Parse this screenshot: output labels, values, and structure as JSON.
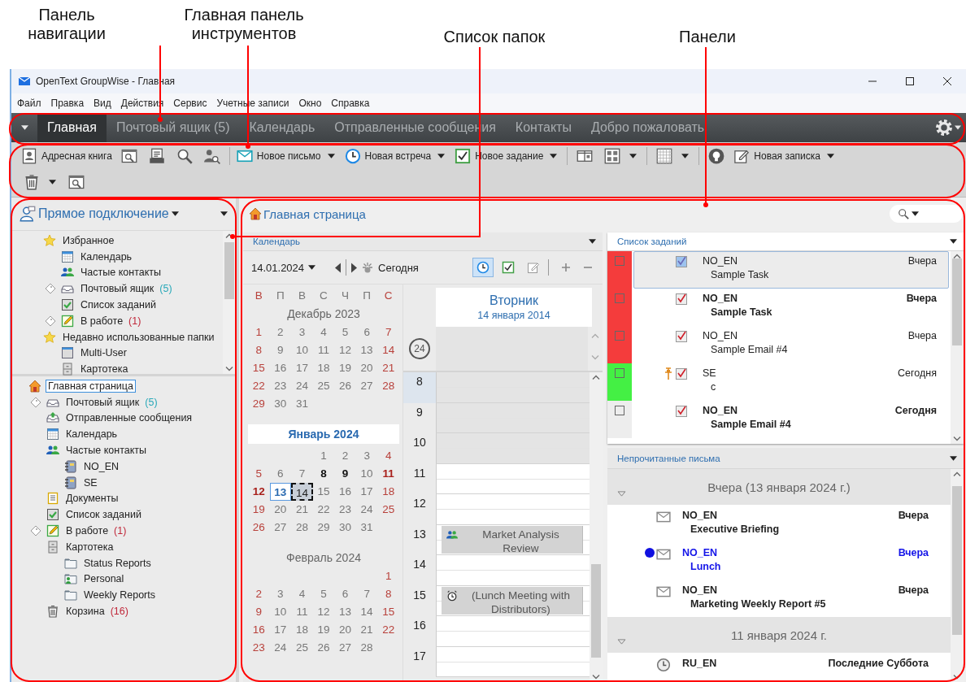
{
  "annotations": [
    {
      "label": "Панель навигации"
    },
    {
      "label": "Главная панель инструментов"
    },
    {
      "label": "Список папок"
    },
    {
      "label": "Панели"
    }
  ],
  "window": {
    "title": "OpenText GroupWise - Главная"
  },
  "menu": [
    "Файл",
    "Правка",
    "Вид",
    "Действия",
    "Сервис",
    "Учетные записи",
    "Окно",
    "Справка"
  ],
  "nav_tabs": [
    {
      "label": "Главная",
      "selected": true
    },
    {
      "label": "Почтовый ящик (5)",
      "selected": false
    },
    {
      "label": "Календарь",
      "selected": false
    },
    {
      "label": "Отправленные сообщения",
      "selected": false
    },
    {
      "label": "Контакты",
      "selected": false
    },
    {
      "label": "Добро пожаловать",
      "selected": false
    }
  ],
  "toolbar": {
    "rows": [
      [
        {
          "kind": "button",
          "label": "Адресная книга"
        },
        {
          "kind": "icon"
        },
        {
          "kind": "icon"
        },
        {
          "kind": "icon"
        },
        {
          "kind": "icon"
        },
        {
          "kind": "separator"
        },
        {
          "kind": "button",
          "label": "Новое письмо",
          "menu": true
        },
        {
          "kind": "button",
          "label": "Новая встреча",
          "menu": true
        },
        {
          "kind": "button",
          "label": "Новое задание",
          "menu": true
        },
        {
          "kind": "separator"
        },
        {
          "kind": "icon"
        },
        {
          "kind": "icon",
          "menu": true
        },
        {
          "kind": "separator"
        },
        {
          "kind": "icon",
          "menu": true
        },
        {
          "kind": "separator"
        },
        {
          "kind": "icon"
        },
        {
          "kind": "button",
          "label": "Новая записка",
          "menu": true
        }
      ],
      [
        {
          "kind": "icon",
          "menu": true
        },
        {
          "kind": "icon"
        }
      ]
    ]
  },
  "folder_panel": {
    "title": "Прямое подключение",
    "favorites": [
      {
        "label": "Избранное",
        "kind": "favorites",
        "selected": false,
        "children": [
          {
            "label": "Календарь",
            "kind": "calendar",
            "selected": false
          },
          {
            "label": "Частые контакты",
            "kind": "contacts",
            "selected": false
          },
          {
            "label": "Почтовый ящик",
            "count": "(5)",
            "color": "#2aa9b9",
            "kind": "mailbox",
            "shared": true,
            "selected": false
          },
          {
            "label": "Список заданий",
            "kind": "tasks",
            "selected": false
          },
          {
            "label": "В работе",
            "count": "(1)",
            "color": "#c0283a",
            "kind": "working",
            "shared": true,
            "selected": false
          }
        ]
      },
      {
        "label": "Недавно использованные папки",
        "kind": "favorites",
        "selected": false,
        "children": [
          {
            "label": "Multi-User",
            "kind": "window",
            "selected": false
          },
          {
            "label": "Картотека",
            "kind": "cabinet",
            "selected": false
          }
        ]
      }
    ],
    "tree": [
      {
        "label": "Главная страница",
        "kind": "home",
        "selected": true,
        "children": [
          {
            "label": "Почтовый ящик",
            "count": "(5)",
            "color": "#2aa9b9",
            "kind": "mailbox",
            "shared": true,
            "selected": false
          },
          {
            "label": "Отправленные сообщения",
            "kind": "sent",
            "selected": false
          },
          {
            "label": "Календарь",
            "kind": "calendar",
            "selected": false
          },
          {
            "label": "Частые контакты",
            "kind": "contacts",
            "selected": false,
            "children": [
              {
                "label": "NO_EN",
                "kind": "addressbook",
                "selected": false
              },
              {
                "label": "SE",
                "kind": "addressbook",
                "selected": false
              }
            ]
          },
          {
            "label": "Документы",
            "kind": "documents",
            "selected": false
          },
          {
            "label": "Список заданий",
            "kind": "tasks",
            "selected": false
          },
          {
            "label": "В работе",
            "count": "(1)",
            "color": "#c0283a",
            "kind": "working",
            "shared": true,
            "selected": false
          },
          {
            "label": "Картотека",
            "kind": "cabinet",
            "selected": false,
            "children": [
              {
                "label": "Status Reports",
                "kind": "folder",
                "selected": false
              },
              {
                "label": "Personal",
                "kind": "personal",
                "selected": false
              },
              {
                "label": "Weekly Reports",
                "kind": "folder",
                "selected": false
              }
            ]
          },
          {
            "label": "Корзина",
            "count": "(16)",
            "color": "#c0283a",
            "kind": "trash",
            "selected": false
          }
        ]
      }
    ]
  },
  "home": {
    "title": "Главная страница"
  },
  "calendar_panel": {
    "title": "Календарь",
    "date": "14.01.2024",
    "today_label": "Сегодня",
    "views": [
      {
        "selected": true
      },
      {
        "selected": false
      },
      {
        "selected": false
      }
    ],
    "weekdays": [
      "В",
      "П",
      "В",
      "С",
      "Ч",
      "П",
      "С"
    ],
    "months": [
      {
        "title": "Декабрь 2023",
        "current": false,
        "weeks": [
          {
            "days": [
              "1",
              "2",
              "3",
              "4",
              "5",
              "6",
              "7"
            ]
          },
          {
            "days": [
              "8",
              "9",
              "10",
              "11",
              "12",
              "13",
              "14"
            ]
          },
          {
            "days": [
              "15",
              "16",
              "17",
              "18",
              "19",
              "20",
              "21"
            ]
          },
          {
            "days": [
              "22",
              "23",
              "24",
              "25",
              "26",
              "27",
              "28"
            ]
          },
          {
            "days": [
              "29",
              "30",
              "31"
            ]
          }
        ]
      },
      {
        "title": "Январь 2024",
        "current": true,
        "weeks": [
          {
            "right_aligned": true,
            "days": [
              "1",
              "2",
              "3",
              "4"
            ]
          },
          {
            "days": [
              "5",
              "6",
              "7",
              {
                "d": "8",
                "bold": true
              },
              {
                "d": "9",
                "bold": true
              },
              "10",
              {
                "d": "11",
                "bold": true
              }
            ]
          },
          {
            "days": [
              {
                "d": "12",
                "bold": true
              },
              {
                "d": "13",
                "today": true
              },
              {
                "d": "14",
                "selected": true
              },
              "15",
              "16",
              "17",
              "18"
            ]
          },
          {
            "days": [
              "19",
              "20",
              "21",
              "22",
              "23",
              "24",
              "25"
            ]
          },
          {
            "days": [
              "26",
              "27",
              "28",
              "29",
              "30",
              "31"
            ]
          }
        ]
      },
      {
        "title": "Февраль 2024",
        "current": false,
        "weeks": [
          {
            "right_aligned": true,
            "days": [
              "1"
            ]
          },
          {
            "days": [
              "2",
              "3",
              "4",
              "5",
              "6",
              "7",
              "8"
            ]
          },
          {
            "days": [
              "9",
              "10",
              "11",
              "12",
              "13",
              "14",
              "15"
            ]
          },
          {
            "days": [
              "16",
              "17",
              "18",
              "19",
              "20",
              "21",
              "22"
            ]
          },
          {
            "days": [
              "23",
              "24",
              "25",
              "26",
              "27",
              "28"
            ]
          }
        ]
      }
    ],
    "day": {
      "weekday": "Вторник",
      "date": "14 января 2014",
      "all_day": "24",
      "hours": [
        {
          "label": "8",
          "working": false,
          "selected": true
        },
        {
          "label": "9",
          "working": false,
          "selected": false
        },
        {
          "label": "10",
          "working": false,
          "selected": false
        },
        {
          "label": "11",
          "working": true,
          "selected": false
        },
        {
          "label": "12",
          "working": true,
          "selected": false
        },
        {
          "label": "13",
          "working": true,
          "selected": false,
          "events": [
            {
              "kind": "meeting",
              "title": "Market Analysis Review"
            }
          ]
        },
        {
          "label": "14",
          "working": true,
          "selected": false
        },
        {
          "label": "15",
          "working": true,
          "selected": false,
          "events": [
            {
              "kind": "reminder",
              "title": "(Lunch Meeting with Distributors)"
            }
          ]
        },
        {
          "label": "16",
          "working": true,
          "selected": false
        },
        {
          "label": "17",
          "working": true,
          "selected": false
        }
      ]
    }
  },
  "tasks_panel": {
    "title": "Список заданий",
    "items": [
      {
        "color": "#f43c3c",
        "checked": false,
        "completed": true,
        "pinned": false,
        "unread": false,
        "selected": true,
        "from": "NO_EN",
        "subject": "Sample Task",
        "date": "Вчера"
      },
      {
        "color": "#f43c3c",
        "checked": false,
        "completed": true,
        "pinned": false,
        "unread": true,
        "selected": false,
        "from": "NO_EN",
        "subject": "Sample Task",
        "date": "Вчера"
      },
      {
        "color": "#f43c3c",
        "checked": false,
        "completed": true,
        "pinned": false,
        "unread": false,
        "selected": false,
        "from": "NO_EN",
        "subject": "Sample Email #4",
        "date": "Вчера"
      },
      {
        "color": "#44f044",
        "checked": false,
        "completed": true,
        "pinned": true,
        "unread": false,
        "selected": false,
        "from": "SE",
        "subject": "c",
        "date": "Сегодня"
      },
      {
        "checked": false,
        "completed": true,
        "pinned": false,
        "unread": true,
        "selected": false,
        "from": "NO_EN",
        "subject": "Sample Email #4",
        "date": "Сегодня"
      }
    ]
  },
  "unread_panel": {
    "title": "Непрочитанные письма",
    "groups": [
      {
        "label": "Вчера (13 января 2024 г.)",
        "expanded": true,
        "items": [
          {
            "kind": "mail",
            "highlighted": false,
            "from": "NO_EN",
            "subject": "Executive Briefing",
            "date": "Вчера"
          },
          {
            "kind": "mail",
            "highlighted": true,
            "from": "NO_EN",
            "subject": "Lunch",
            "date": "Вчера"
          },
          {
            "kind": "mail",
            "highlighted": false,
            "from": "NO_EN",
            "subject": "Marketing Weekly Report #5",
            "date": "Вчера"
          }
        ]
      },
      {
        "label": "11 января 2024 г.",
        "expanded": true,
        "items": [
          {
            "kind": "appointment",
            "highlighted": false,
            "from": "RU_EN",
            "date": "Последние Суббота"
          }
        ]
      }
    ]
  }
}
